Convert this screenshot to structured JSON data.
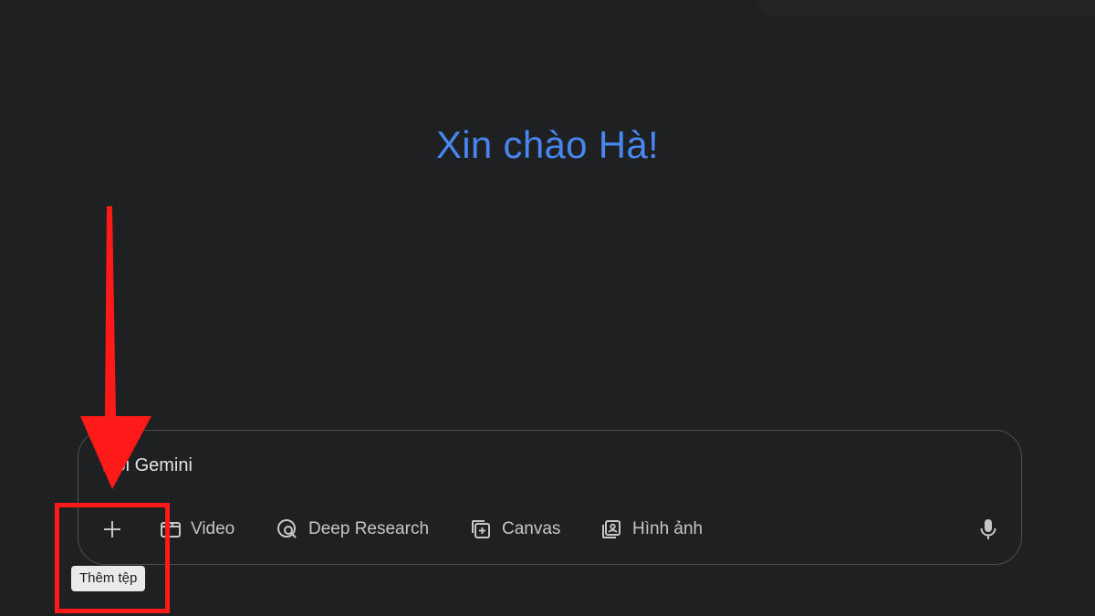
{
  "greeting": "Xin chào Hà!",
  "prompt": {
    "placeholder": "Hỏi Gemini"
  },
  "toolbar": {
    "add_icon": "plus-icon",
    "add_tooltip": "Thêm tệp",
    "items": [
      {
        "label": "Video",
        "icon": "video-icon"
      },
      {
        "label": "Deep Research",
        "icon": "deep-research-icon"
      },
      {
        "label": "Canvas",
        "icon": "canvas-icon"
      },
      {
        "label": "Hình ảnh",
        "icon": "image-icon"
      }
    ],
    "mic_icon": "microphone-icon"
  },
  "annotation": {
    "arrow_color": "#ff1a1a",
    "box_color": "#ff1a1a"
  },
  "colors": {
    "background": "#1f2021",
    "greeting": "#4a86f0",
    "text": "#c4c7c5"
  }
}
